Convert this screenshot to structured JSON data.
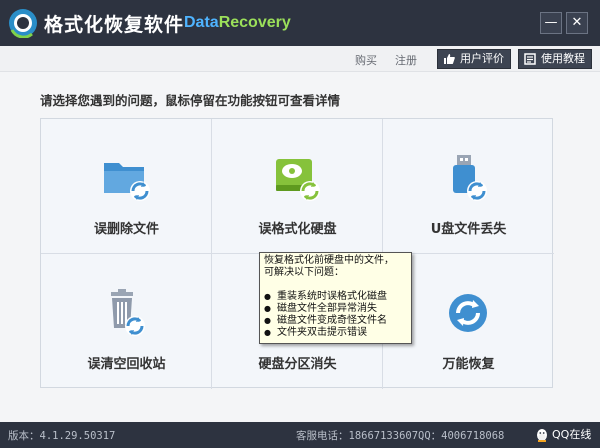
{
  "window": {
    "title": "格式化恢复软件",
    "brand_data": "Data",
    "brand_recovery": "Recovery",
    "minimize_glyph": "—",
    "close_glyph": "✕"
  },
  "toolbar": {
    "buy_label": "购买",
    "register_label": "注册",
    "review_label": "用户评价",
    "tutorial_label": "使用教程"
  },
  "main": {
    "prompt": "请选择您遇到的问题，鼠标停留在功能按钮可查看详情",
    "options": [
      {
        "label": "误删除文件",
        "icon": "folder-recover-icon"
      },
      {
        "label": "误格式化硬盘",
        "icon": "harddisk-recover-icon"
      },
      {
        "label": "U盘文件丢失",
        "icon": "usb-recover-icon"
      },
      {
        "label": "误清空回收站",
        "icon": "recycle-bin-recover-icon"
      },
      {
        "label": "硬盘分区消失",
        "icon": "partition-icon"
      },
      {
        "label": "万能恢复",
        "icon": "universal-recover-icon"
      }
    ]
  },
  "tooltip": {
    "line1": "恢复格式化前硬盘中的文件，",
    "line2": "可解决以下问题：",
    "items": [
      "重装系统时误格式化磁盘",
      "磁盘文件全部异常消失",
      "磁盘文件变成奇怪文件名",
      "文件夹双击提示错误"
    ]
  },
  "status": {
    "version": "版本：4.1.29.50317",
    "phone": "客服电话：18667133607",
    "qq": "QQ：4006718068",
    "online_label": "QQ在线"
  },
  "colors": {
    "titlebar": "#2d3340",
    "icon_blue": "#3f8fd0",
    "icon_green": "#86c23b",
    "tooltip_bg": "#ffffe6"
  }
}
